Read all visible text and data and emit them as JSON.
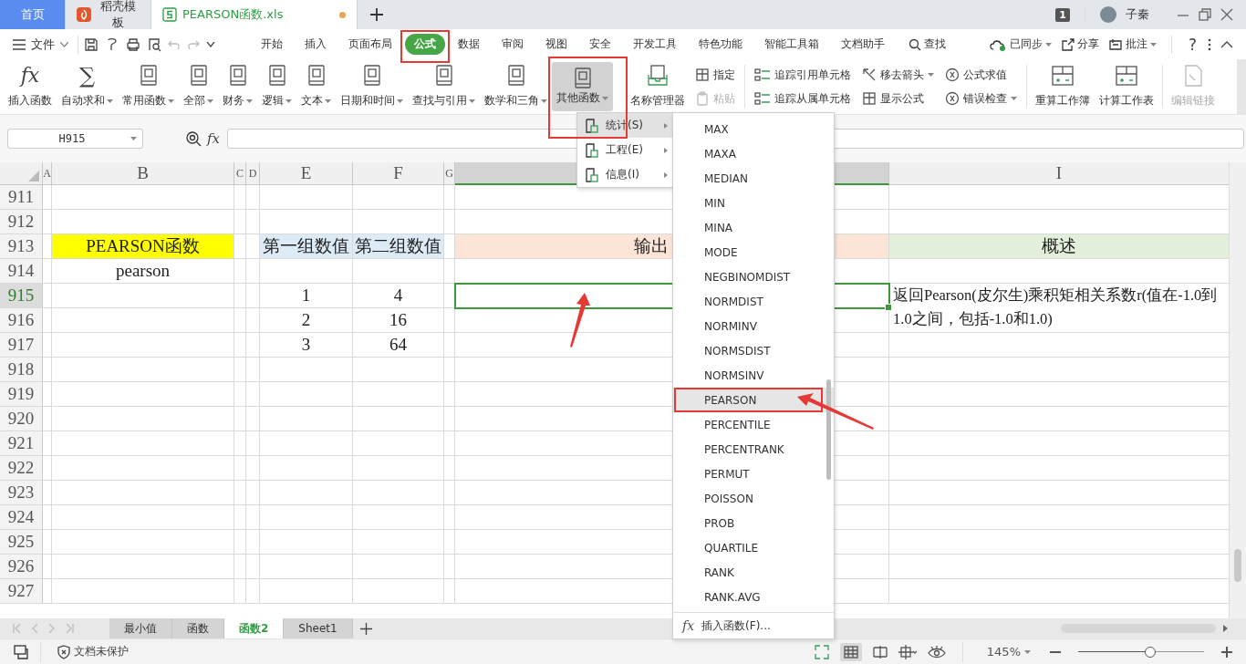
{
  "doc_tabs": [
    {
      "label": "首页",
      "kind": "home",
      "selected": false,
      "unsaved": false
    },
    {
      "label": "稻壳模板",
      "kind": "docer",
      "selected": false,
      "unsaved": false
    },
    {
      "label": "PEARSON函数.xls",
      "kind": "sheet",
      "selected": true,
      "unsaved": true
    }
  ],
  "account": {
    "badge": "1",
    "user": "子秦"
  },
  "menu_bar": {
    "file": "文件",
    "tabs": [
      {
        "label": "开始",
        "selected": false,
        "annotated": false
      },
      {
        "label": "插入",
        "selected": false,
        "annotated": false
      },
      {
        "label": "页面布局",
        "selected": false,
        "annotated": false
      },
      {
        "label": "公式",
        "selected": true,
        "annotated": true
      },
      {
        "label": "数据",
        "selected": false,
        "annotated": false
      },
      {
        "label": "审阅",
        "selected": false,
        "annotated": false
      },
      {
        "label": "视图",
        "selected": false,
        "annotated": false
      },
      {
        "label": "安全",
        "selected": false,
        "annotated": false
      },
      {
        "label": "开发工具",
        "selected": false,
        "annotated": false
      },
      {
        "label": "特色功能",
        "selected": false,
        "annotated": false
      },
      {
        "label": "智能工具箱",
        "selected": false,
        "annotated": false
      },
      {
        "label": "文档助手",
        "selected": false,
        "annotated": false
      }
    ],
    "search": "查找",
    "sync": "已同步",
    "share": "分享",
    "comment": "批注",
    "help": "?"
  },
  "ribbon": [
    {
      "kind": "large",
      "label": "插入函数",
      "icon_text": "fx",
      "dropdown": false,
      "pressed": false,
      "disabled": false,
      "annotated": false
    },
    {
      "kind": "large",
      "label": "自动求和",
      "icon_text": "∑",
      "dropdown": true,
      "pressed": false,
      "disabled": false,
      "annotated": false
    },
    {
      "kind": "large",
      "label": "常用函数",
      "dropdown": true,
      "pressed": false,
      "disabled": false,
      "annotated": false
    },
    {
      "kind": "large",
      "label": "全部",
      "dropdown": true,
      "pressed": false,
      "disabled": false,
      "annotated": false
    },
    {
      "kind": "large",
      "label": "财务",
      "dropdown": true,
      "pressed": false,
      "disabled": false,
      "annotated": false
    },
    {
      "kind": "large",
      "label": "逻辑",
      "dropdown": true,
      "pressed": false,
      "disabled": false,
      "annotated": false
    },
    {
      "kind": "large",
      "label": "文本",
      "dropdown": true,
      "pressed": false,
      "disabled": false,
      "annotated": false
    },
    {
      "kind": "large",
      "label": "日期和时间",
      "dropdown": true,
      "pressed": false,
      "disabled": false,
      "annotated": false
    },
    {
      "kind": "large",
      "label": "查找与引用",
      "dropdown": true,
      "pressed": false,
      "disabled": false,
      "annotated": false
    },
    {
      "kind": "large",
      "label": "数学和三角",
      "dropdown": true,
      "pressed": false,
      "disabled": false,
      "annotated": false
    },
    {
      "kind": "large",
      "label": "其他函数",
      "dropdown": true,
      "pressed": true,
      "disabled": false,
      "annotated": true
    },
    {
      "kind": "large",
      "label": "名称管理器",
      "dropdown": false,
      "pressed": false,
      "disabled": false,
      "annotated": false
    },
    {
      "kind": "stack",
      "items": [
        {
          "label": "指定",
          "dropdown": false,
          "disabled": false
        },
        {
          "label": "粘贴",
          "dropdown": false,
          "disabled": true
        }
      ]
    },
    {
      "kind": "separator"
    },
    {
      "kind": "stack",
      "items": [
        {
          "label": "追踪引用单元格",
          "dropdown": false,
          "disabled": false
        },
        {
          "label": "追踪从属单元格",
          "dropdown": false,
          "disabled": false
        }
      ]
    },
    {
      "kind": "stack",
      "items": [
        {
          "label": "移去箭头",
          "dropdown": true,
          "disabled": false
        },
        {
          "label": "显示公式",
          "dropdown": false,
          "disabled": false
        }
      ]
    },
    {
      "kind": "stack",
      "items": [
        {
          "label": "公式求值",
          "dropdown": false,
          "disabled": false
        },
        {
          "label": "错误检查",
          "dropdown": true,
          "disabled": false
        }
      ]
    },
    {
      "kind": "separator"
    },
    {
      "kind": "large",
      "label": "重算工作簿",
      "dropdown": false,
      "pressed": false,
      "disabled": false,
      "annotated": false
    },
    {
      "kind": "large",
      "label": "计算工作表",
      "dropdown": false,
      "pressed": false,
      "disabled": false,
      "annotated": false
    },
    {
      "kind": "separator"
    },
    {
      "kind": "large",
      "label": "编辑链接",
      "dropdown": false,
      "pressed": false,
      "disabled": true,
      "annotated": false
    }
  ],
  "formula_bar": {
    "cell": "H915",
    "fx": "fx"
  },
  "columns": [
    {
      "label": "A",
      "selected": false
    },
    {
      "label": "B",
      "selected": false
    },
    {
      "label": "C",
      "selected": false
    },
    {
      "label": "D",
      "selected": false
    },
    {
      "label": "E",
      "selected": false
    },
    {
      "label": "F",
      "selected": false
    },
    {
      "label": "G",
      "selected": false
    },
    {
      "selected": true
    },
    {
      "label": "I",
      "selected": false
    }
  ],
  "rows": [
    {
      "number": "911",
      "selected": false
    },
    {
      "number": "912",
      "selected": false
    },
    {
      "number": "913",
      "selected": false,
      "cells": {
        "column_b": {
          "text": "PEARSON函数",
          "color": "#ffff00"
        },
        "column_e": {
          "text": "第一组数值",
          "color": "#ddebf7"
        },
        "column_f": {
          "text": "第二组数值",
          "color": "#ddebf7"
        },
        "column_h": {
          "text": "输出",
          "color": "#fce4d6"
        },
        "column_i": {
          "text": "概述",
          "color": "#e2efda"
        }
      }
    },
    {
      "number": "914",
      "selected": false,
      "cells": {
        "column_b": {
          "text": "pearson"
        }
      }
    },
    {
      "number": "915",
      "selected": true,
      "cells": {
        "column_e": {
          "text": "1"
        },
        "column_f": {
          "text": "4"
        },
        "column_h": {
          "selected": true,
          "pointed": true
        },
        "column_i": {
          "text": "返回Pearson(皮尔生)乘积矩相关系数r(值在-1.0到1.0之间，包括-1.0和1.0)",
          "merged": true
        }
      }
    },
    {
      "number": "916",
      "selected": false,
      "cells": {
        "column_e": {
          "text": "2"
        },
        "column_f": {
          "text": "16"
        }
      }
    },
    {
      "number": "917",
      "selected": false,
      "cells": {
        "column_e": {
          "text": "3"
        },
        "column_f": {
          "text": "64"
        }
      }
    },
    {
      "number": "918",
      "selected": false
    },
    {
      "number": "919",
      "selected": false
    },
    {
      "number": "920",
      "selected": false
    },
    {
      "number": "921",
      "selected": false
    },
    {
      "number": "922",
      "selected": false
    },
    {
      "number": "923",
      "selected": false
    },
    {
      "number": "924",
      "selected": false
    },
    {
      "number": "925",
      "selected": false
    },
    {
      "number": "926",
      "selected": false
    },
    {
      "number": "927",
      "selected": false
    }
  ],
  "menu": {
    "items": [
      {
        "label": "统计(S)",
        "selected": true
      },
      {
        "label": "工程(E)",
        "selected": false
      },
      {
        "label": "信息(I)",
        "selected": false
      }
    ]
  },
  "submenu": {
    "items": [
      {
        "label": "MAX",
        "selected": false,
        "annotated": false,
        "pointed": false
      },
      {
        "label": "MAXA",
        "selected": false,
        "annotated": false,
        "pointed": false
      },
      {
        "label": "MEDIAN",
        "selected": false,
        "annotated": false,
        "pointed": false
      },
      {
        "label": "MIN",
        "selected": false,
        "annotated": false,
        "pointed": false
      },
      {
        "label": "MINA",
        "selected": false,
        "annotated": false,
        "pointed": false
      },
      {
        "label": "MODE",
        "selected": false,
        "annotated": false,
        "pointed": false
      },
      {
        "label": "NEGBINOMDIST",
        "selected": false,
        "annotated": false,
        "pointed": false
      },
      {
        "label": "NORMDIST",
        "selected": false,
        "annotated": false,
        "pointed": false
      },
      {
        "label": "NORMINV",
        "selected": false,
        "annotated": false,
        "pointed": false
      },
      {
        "label": "NORMSDIST",
        "selected": false,
        "annotated": false,
        "pointed": false
      },
      {
        "label": "NORMSINV",
        "selected": false,
        "annotated": false,
        "pointed": false
      },
      {
        "label": "PEARSON",
        "selected": true,
        "annotated": true,
        "pointed": true
      },
      {
        "label": "PERCENTILE",
        "selected": false,
        "annotated": false,
        "pointed": false
      },
      {
        "label": "PERCENTRANK",
        "selected": false,
        "annotated": false,
        "pointed": false
      },
      {
        "label": "PERMUT",
        "selected": false,
        "annotated": false,
        "pointed": false
      },
      {
        "label": "POISSON",
        "selected": false,
        "annotated": false,
        "pointed": false
      },
      {
        "label": "PROB",
        "selected": false,
        "annotated": false,
        "pointed": false
      },
      {
        "label": "QUARTILE",
        "selected": false,
        "annotated": false,
        "pointed": false
      },
      {
        "label": "RANK",
        "selected": false,
        "annotated": false,
        "pointed": false
      },
      {
        "label": "RANK.AVG",
        "selected": false,
        "annotated": false,
        "pointed": false
      }
    ],
    "footer": {
      "icon_text": "fx",
      "label": "插入函数(F)..."
    }
  },
  "sheet_tabs": [
    {
      "label": "最小值",
      "selected": false
    },
    {
      "label": "函数",
      "selected": false
    },
    {
      "label": "函数2",
      "selected": true
    },
    {
      "label": "Sheet1",
      "selected": false
    }
  ],
  "status_bar": {
    "protection": "文档未保护",
    "zoom": "145%",
    "zoom_slider": {
      "level": 0.57
    }
  }
}
